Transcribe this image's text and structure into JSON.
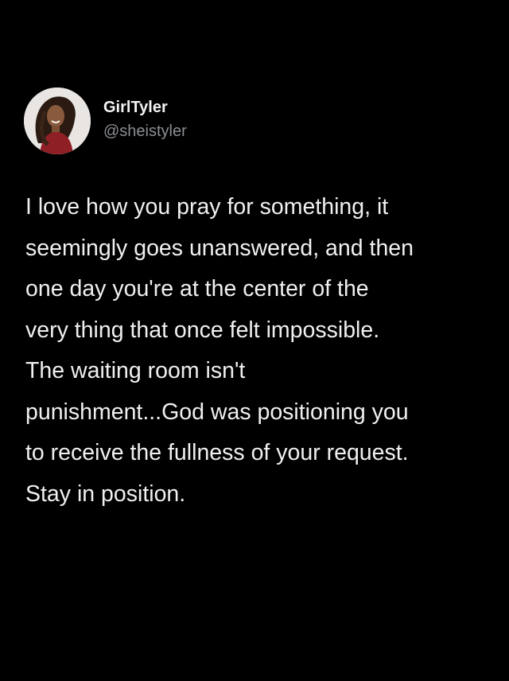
{
  "tweet": {
    "author": {
      "display_name": "GirlTyler",
      "handle": "@sheistyler",
      "avatar_icon": "profile-photo"
    },
    "text_lines": [
      "I love how you pray for something, it",
      "seemingly goes unanswered, and then",
      "one day you're at the center of the",
      "very thing that once felt impossible.",
      "The waiting room isn't",
      "punishment...God was positioning you",
      "to receive the fullness of your request.",
      "Stay in position."
    ]
  },
  "colors": {
    "background": "#000000",
    "text": "#f0f0f0",
    "handle": "#8b8e92"
  }
}
